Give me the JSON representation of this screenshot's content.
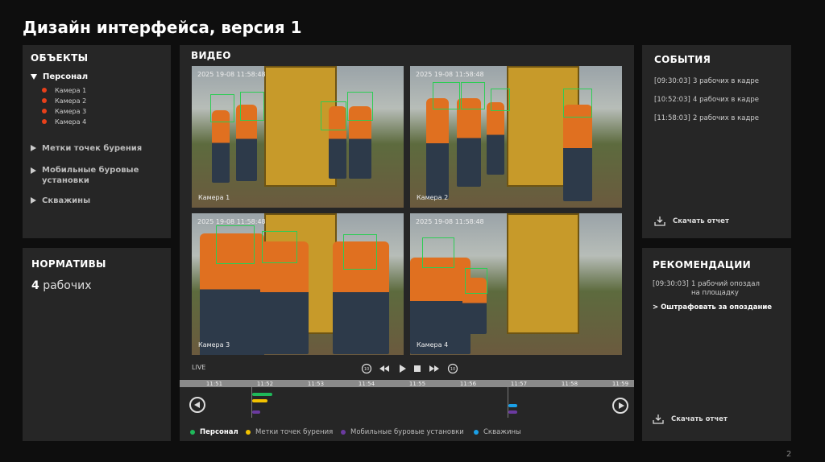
{
  "title": "Дизайн интерфейса, версия 1",
  "objects": {
    "title": "ОБЪЕКТЫ",
    "personnel": {
      "label": "Персонал",
      "cameras": [
        "Камера 1",
        "Камера 2",
        "Камера 3",
        "Камера 4"
      ],
      "dot_color": "#e8401a"
    },
    "items": [
      "Метки точек бурения",
      "Мобильные буровые установки",
      "Скважины"
    ]
  },
  "norms": {
    "title": "НОРМАТИВЫ",
    "count": "4",
    "unit": " рабочих"
  },
  "video": {
    "title": "ВИДЕО",
    "feeds": [
      {
        "timestamp": "2025 19-08 11:58:48",
        "label": "Камера 1"
      },
      {
        "timestamp": "2025 19-08 11:58:48",
        "label": "Камера 2"
      },
      {
        "timestamp": "2025 19-08 11:58:48",
        "label": "Камера 3"
      },
      {
        "timestamp": "2025 19-08 11:58:48",
        "label": "Камера 4"
      }
    ],
    "live": "LIVE",
    "timeline_ticks": [
      "11:51",
      "11:52",
      "11:53",
      "11:54",
      "11:55",
      "11:56",
      "11:57",
      "11:58",
      "11:59"
    ],
    "legend": [
      {
        "label": "Персонал",
        "color": "#1fb85a"
      },
      {
        "label": "Метки точек бурения",
        "color": "#f2c200"
      },
      {
        "label": "Мобильные буровые установки",
        "color": "#6b3aa0"
      },
      {
        "label": "Скважины",
        "color": "#1aa0e8"
      }
    ]
  },
  "events": {
    "title": "СОБЫТИЯ",
    "items": [
      {
        "time": "[09:30:03]",
        "text": "3 рабочих в кадре"
      },
      {
        "time": "[10:52:03]",
        "text": "4 рабочих в кадре"
      },
      {
        "time": "[11:58:03]",
        "text": "2 рабочих в кадре"
      }
    ],
    "download": "Скачать отчет"
  },
  "recs": {
    "title": "РЕКОМЕНДАЦИИ",
    "time": "[09:30:03]",
    "text1": "1 рабочий опоздал",
    "text2": "на площадку",
    "action": "> Оштрафовать за опоздание",
    "download": "Скачать отчет"
  },
  "page_number": "2"
}
